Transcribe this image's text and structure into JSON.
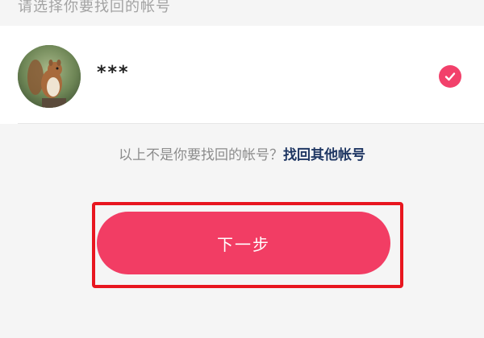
{
  "header": {
    "title": "请选择你要找回的帐号"
  },
  "account": {
    "name": "***",
    "avatar_icon": "squirrel-avatar",
    "selected": true,
    "check_icon": "checkmark-icon"
  },
  "other": {
    "question": "以上不是你要找回的帐号？",
    "link": "找回其他帐号"
  },
  "actions": {
    "next_label": "下一步"
  },
  "colors": {
    "accent": "#f23d64",
    "link": "#1f3763",
    "highlight": "#e8161f"
  }
}
